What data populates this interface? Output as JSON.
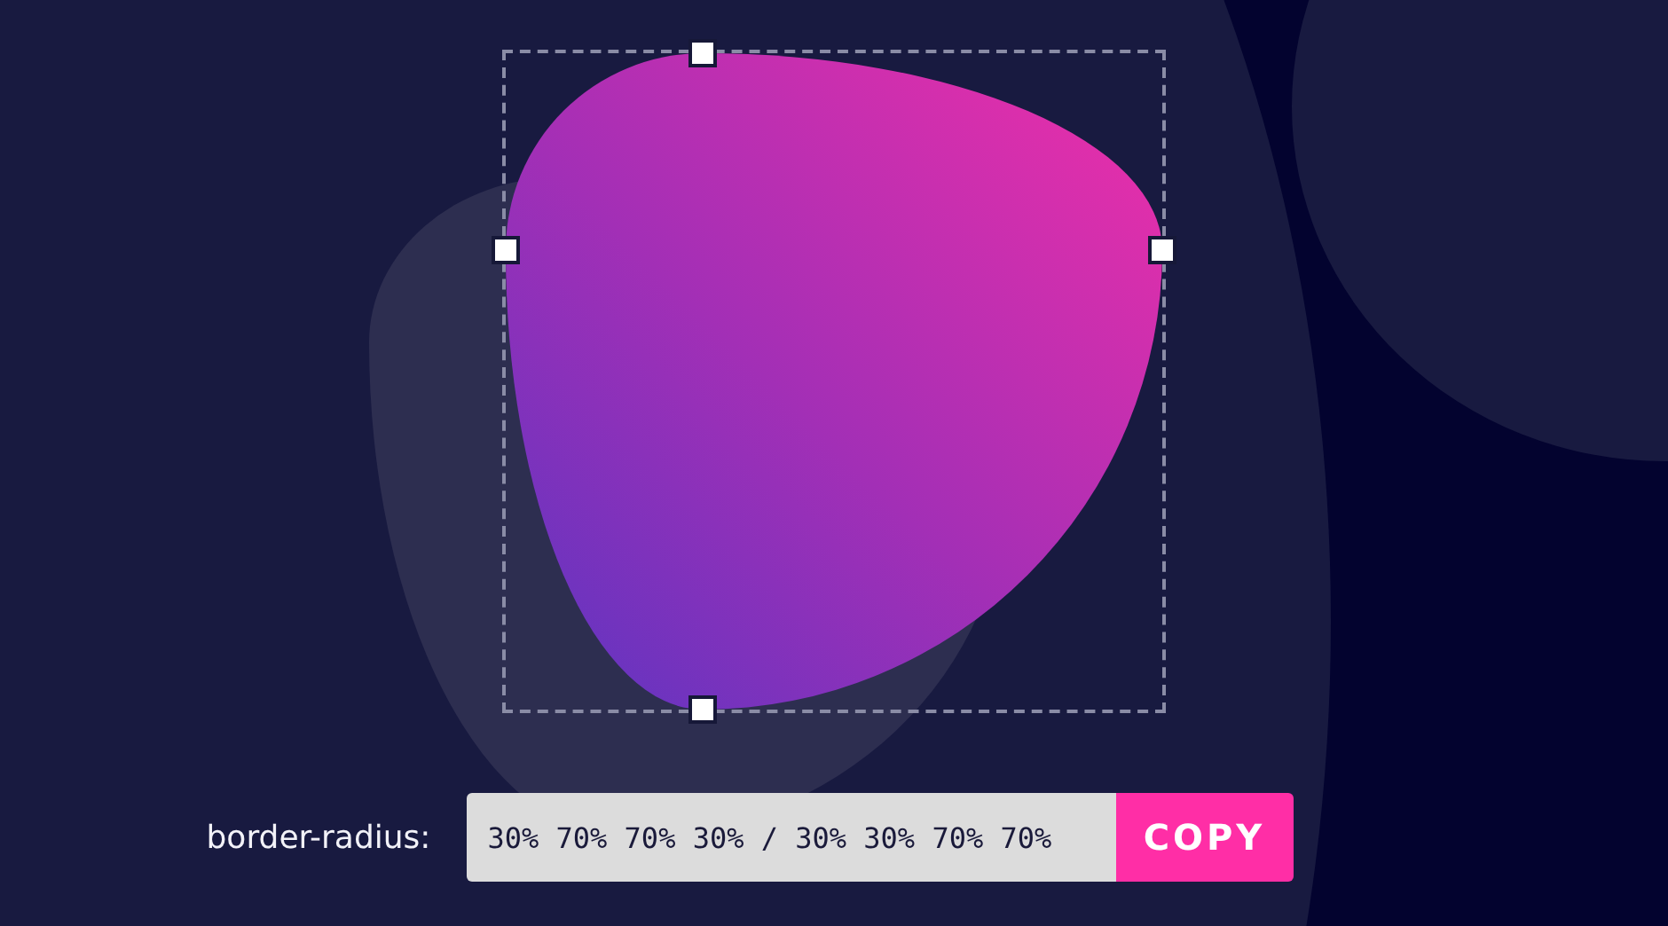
{
  "editor": {
    "label": "border-radius:",
    "value": "30% 70% 70% 30% / 30% 30% 70% 70%",
    "button": "COPY"
  }
}
